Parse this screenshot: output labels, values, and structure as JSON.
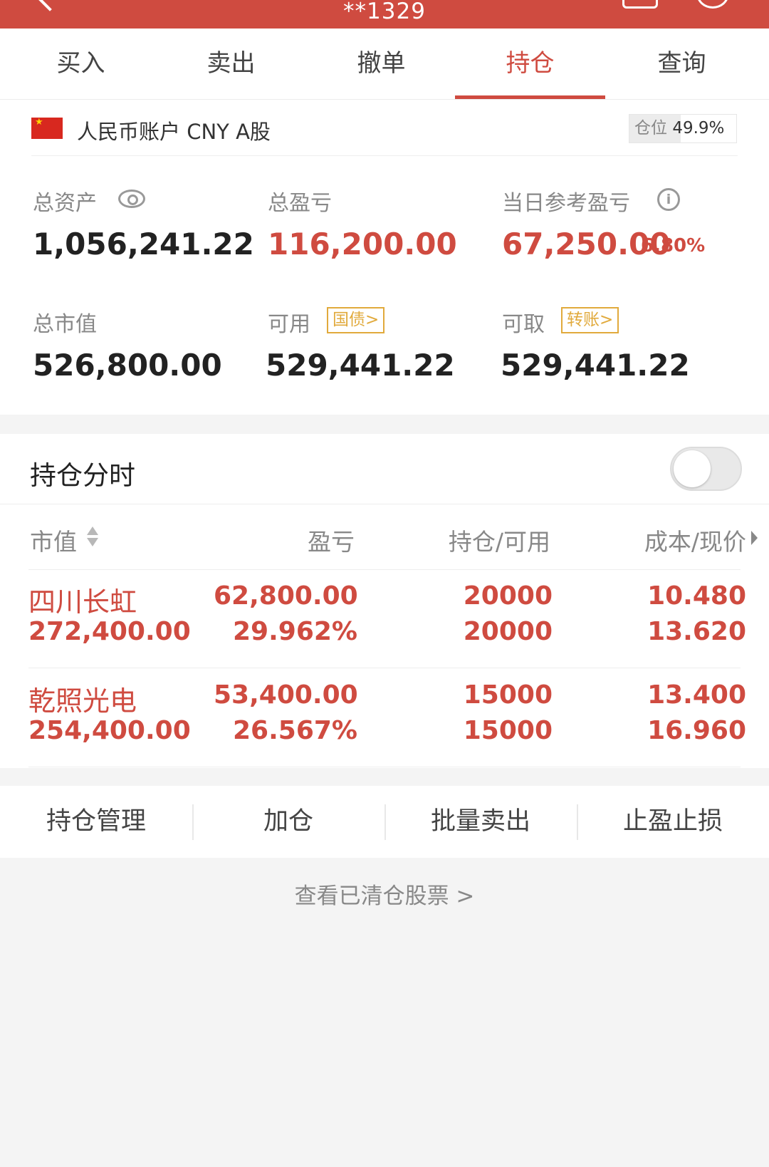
{
  "header": {
    "account": "**1329"
  },
  "tabs": [
    {
      "label": "买入"
    },
    {
      "label": "卖出"
    },
    {
      "label": "撤单"
    },
    {
      "label": "持仓"
    },
    {
      "label": "查询"
    }
  ],
  "active_tab": "持仓",
  "account": {
    "name": "人民币账户 CNY A股",
    "position_label": "仓位",
    "position_value": "49.9%"
  },
  "summary": {
    "total_assets_label": "总资产",
    "total_assets": "1,056,241.22",
    "total_pnl_label": "总盈亏",
    "total_pnl": "116,200.00",
    "daily_pnl_label": "当日参考盈亏",
    "daily_pnl": "67,250.00",
    "daily_pnl_pct": "6.80%",
    "market_value_label": "总市值",
    "market_value": "526,800.00",
    "available_label": "可用",
    "available_chip": "国债>",
    "available": "529,441.22",
    "withdrawable_label": "可取",
    "withdrawable_chip": "转账>",
    "withdrawable": "529,441.22"
  },
  "holdings": {
    "title": "持仓分时",
    "toggle_on": false,
    "columns": {
      "market_value": "市值",
      "pnl": "盈亏",
      "position": "持仓/可用",
      "cost_price": "成本/现价"
    },
    "rows": [
      {
        "name": "四川长虹",
        "market_value": "272,400.00",
        "pnl": "62,800.00",
        "pnl_pct": "29.962%",
        "position": "20000",
        "available": "20000",
        "cost": "10.480",
        "price": "13.620"
      },
      {
        "name": "乾照光电",
        "market_value": "254,400.00",
        "pnl": "53,400.00",
        "pnl_pct": "26.567%",
        "position": "15000",
        "available": "15000",
        "cost": "13.400",
        "price": "16.960"
      }
    ]
  },
  "actions": [
    {
      "label": "持仓管理"
    },
    {
      "label": "加仓"
    },
    {
      "label": "批量卖出"
    },
    {
      "label": "止盈止损"
    }
  ],
  "cleared_link": "查看已清仓股票 >",
  "colors": {
    "accent": "#cf4b40",
    "chip": "#e1aa3c"
  }
}
